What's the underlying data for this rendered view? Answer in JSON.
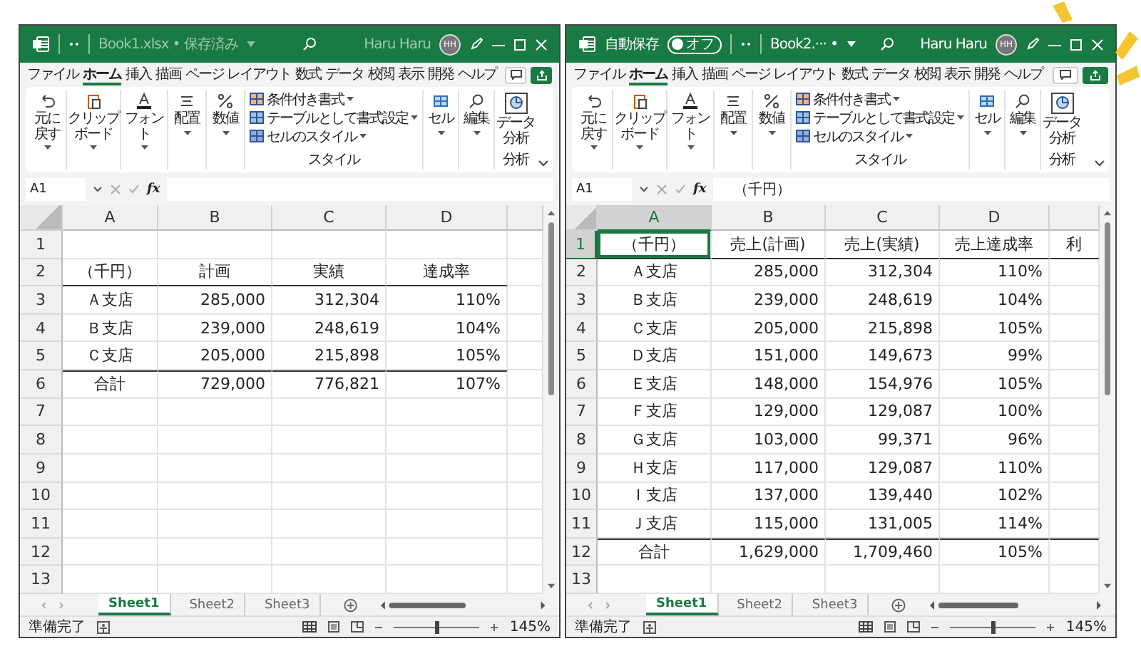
{
  "windows": [
    {
      "active": false,
      "title": "Book1.xlsx • 保存済み",
      "user": "Haru Haru",
      "avatar": "HH",
      "tabs": [
        {
          "label": "ファイル",
          "selected": false
        },
        {
          "label": "ホーム",
          "selected": true
        },
        {
          "label": "挿入",
          "selected": false
        },
        {
          "label": "描画",
          "selected": false
        },
        {
          "label": "ページ レイアウト",
          "selected": false
        },
        {
          "label": "数式",
          "selected": false
        },
        {
          "label": "データ",
          "selected": false
        },
        {
          "label": "校閲",
          "selected": false
        },
        {
          "label": "表示",
          "selected": false
        },
        {
          "label": "開発",
          "selected": false
        },
        {
          "label": "ヘルプ",
          "selected": false
        }
      ],
      "ribbon": [
        {
          "kind": "button",
          "label": "元に戻す"
        },
        {
          "kind": "button",
          "label": "クリップボード"
        },
        {
          "kind": "button",
          "label": "フォント"
        },
        {
          "kind": "button",
          "label": "配置"
        },
        {
          "kind": "button",
          "label": "数値"
        },
        {
          "kind": "styles",
          "items": [
            "条件付き書式",
            "テーブルとして書式設定",
            "セルのスタイル"
          ],
          "label": "スタイル"
        },
        {
          "kind": "button",
          "label": "セル"
        },
        {
          "kind": "button",
          "label": "編集"
        },
        {
          "kind": "analysis",
          "button": "データ分析",
          "label": "分析"
        }
      ],
      "formula_bar": {
        "name_box": "A1",
        "function_button": "fx"
      },
      "columns": [
        "A",
        "B",
        "C",
        "D"
      ],
      "rows": [
        {
          "num": "1",
          "kind": "empty",
          "cells": []
        },
        {
          "num": "2",
          "kind": "header",
          "cells": [
            "（千円）",
            "計画",
            "実績",
            "達成率"
          ]
        },
        {
          "num": "3",
          "kind": "body",
          "cells": [
            "Ａ支店",
            "285,000",
            "312,304",
            "110%"
          ]
        },
        {
          "num": "4",
          "kind": "body",
          "cells": [
            "Ｂ支店",
            "239,000",
            "248,619",
            "104%"
          ]
        },
        {
          "num": "5",
          "kind": "body",
          "cells": [
            "Ｃ支店",
            "205,000",
            "215,898",
            "105%"
          ]
        },
        {
          "num": "6",
          "kind": "total",
          "cells": [
            "合計",
            "729,000",
            "776,821",
            "107%"
          ]
        },
        {
          "num": "7",
          "kind": "empty",
          "cells": []
        },
        {
          "num": "8",
          "kind": "empty",
          "cells": []
        },
        {
          "num": "9",
          "kind": "empty",
          "cells": []
        },
        {
          "num": "10",
          "kind": "empty",
          "cells": []
        },
        {
          "num": "11",
          "kind": "empty",
          "cells": []
        },
        {
          "num": "12",
          "kind": "empty",
          "cells": []
        },
        {
          "num": "13",
          "kind": "empty",
          "cells": []
        }
      ],
      "sheets": [
        {
          "label": "Sheet1",
          "selected": true
        },
        {
          "label": "Sheet2",
          "selected": false
        },
        {
          "label": "Sheet3",
          "selected": false
        }
      ],
      "status": "準備完了",
      "zoom": {
        "level": 0.5,
        "reading": "145%"
      }
    },
    {
      "active": true,
      "autosave": {
        "label": "自動保存",
        "state": "オフ",
        "on": false
      },
      "title": "Book2.··· •",
      "user": "Haru Haru",
      "avatar": "HH",
      "tabs": [
        {
          "label": "ファイル",
          "selected": false
        },
        {
          "label": "ホーム",
          "selected": true
        },
        {
          "label": "挿入",
          "selected": false
        },
        {
          "label": "描画",
          "selected": false
        },
        {
          "label": "ページ レイアウト",
          "selected": false
        },
        {
          "label": "数式",
          "selected": false
        },
        {
          "label": "データ",
          "selected": false
        },
        {
          "label": "校閲",
          "selected": false
        },
        {
          "label": "表示",
          "selected": false
        },
        {
          "label": "開発",
          "selected": false
        },
        {
          "label": "ヘルプ",
          "selected": false
        }
      ],
      "ribbon": [
        {
          "kind": "button",
          "label": "元に戻す"
        },
        {
          "kind": "button",
          "label": "クリップボード"
        },
        {
          "kind": "button",
          "label": "フォント"
        },
        {
          "kind": "button",
          "label": "配置"
        },
        {
          "kind": "button",
          "label": "数値"
        },
        {
          "kind": "styles",
          "items": [
            "条件付き書式",
            "テーブルとして書式設定",
            "セルのスタイル"
          ],
          "label": "スタイル"
        },
        {
          "kind": "button",
          "label": "セル"
        },
        {
          "kind": "button",
          "label": "編集"
        },
        {
          "kind": "analysis",
          "button": "データ分析",
          "label": "分析"
        }
      ],
      "formula_bar": {
        "name_box": "A1",
        "function_button": "fx",
        "value": "（千円）"
      },
      "columns": [
        "A",
        "B",
        "C",
        "D"
      ],
      "rows": [
        {
          "num": "1",
          "kind": "header",
          "cells": [
            "（千円）",
            "売上(計画)",
            "売上(実績)",
            "売上達成率",
            "利"
          ]
        },
        {
          "num": "2",
          "kind": "body",
          "cells": [
            "Ａ支店",
            "285,000",
            "312,304",
            "110%"
          ]
        },
        {
          "num": "3",
          "kind": "body",
          "cells": [
            "Ｂ支店",
            "239,000",
            "248,619",
            "104%"
          ]
        },
        {
          "num": "4",
          "kind": "body",
          "cells": [
            "Ｃ支店",
            "205,000",
            "215,898",
            "105%"
          ]
        },
        {
          "num": "5",
          "kind": "body",
          "cells": [
            "Ｄ支店",
            "151,000",
            "149,673",
            "99%"
          ]
        },
        {
          "num": "6",
          "kind": "body",
          "cells": [
            "Ｅ支店",
            "148,000",
            "154,976",
            "105%"
          ]
        },
        {
          "num": "7",
          "kind": "body",
          "cells": [
            "Ｆ支店",
            "129,000",
            "129,087",
            "100%"
          ]
        },
        {
          "num": "8",
          "kind": "body",
          "cells": [
            "Ｇ支店",
            "103,000",
            "99,371",
            "96%"
          ]
        },
        {
          "num": "9",
          "kind": "body",
          "cells": [
            "Ｈ支店",
            "117,000",
            "129,087",
            "110%"
          ]
        },
        {
          "num": "10",
          "kind": "body",
          "cells": [
            "Ｉ支店",
            "137,000",
            "139,440",
            "102%"
          ]
        },
        {
          "num": "11",
          "kind": "body",
          "cells": [
            "Ｊ支店",
            "115,000",
            "131,005",
            "114%"
          ]
        },
        {
          "num": "12",
          "kind": "total",
          "cells": [
            "合計",
            "1,629,000",
            "1,709,460",
            "105%"
          ]
        },
        {
          "num": "13",
          "kind": "empty",
          "cells": []
        }
      ],
      "sheets": [
        {
          "label": "Sheet1",
          "selected": true
        },
        {
          "label": "Sheet2",
          "selected": false
        },
        {
          "label": "Sheet3",
          "selected": false
        }
      ],
      "status": "準備完了",
      "zoom": {
        "level": 0.5,
        "reading": "145%"
      }
    }
  ]
}
